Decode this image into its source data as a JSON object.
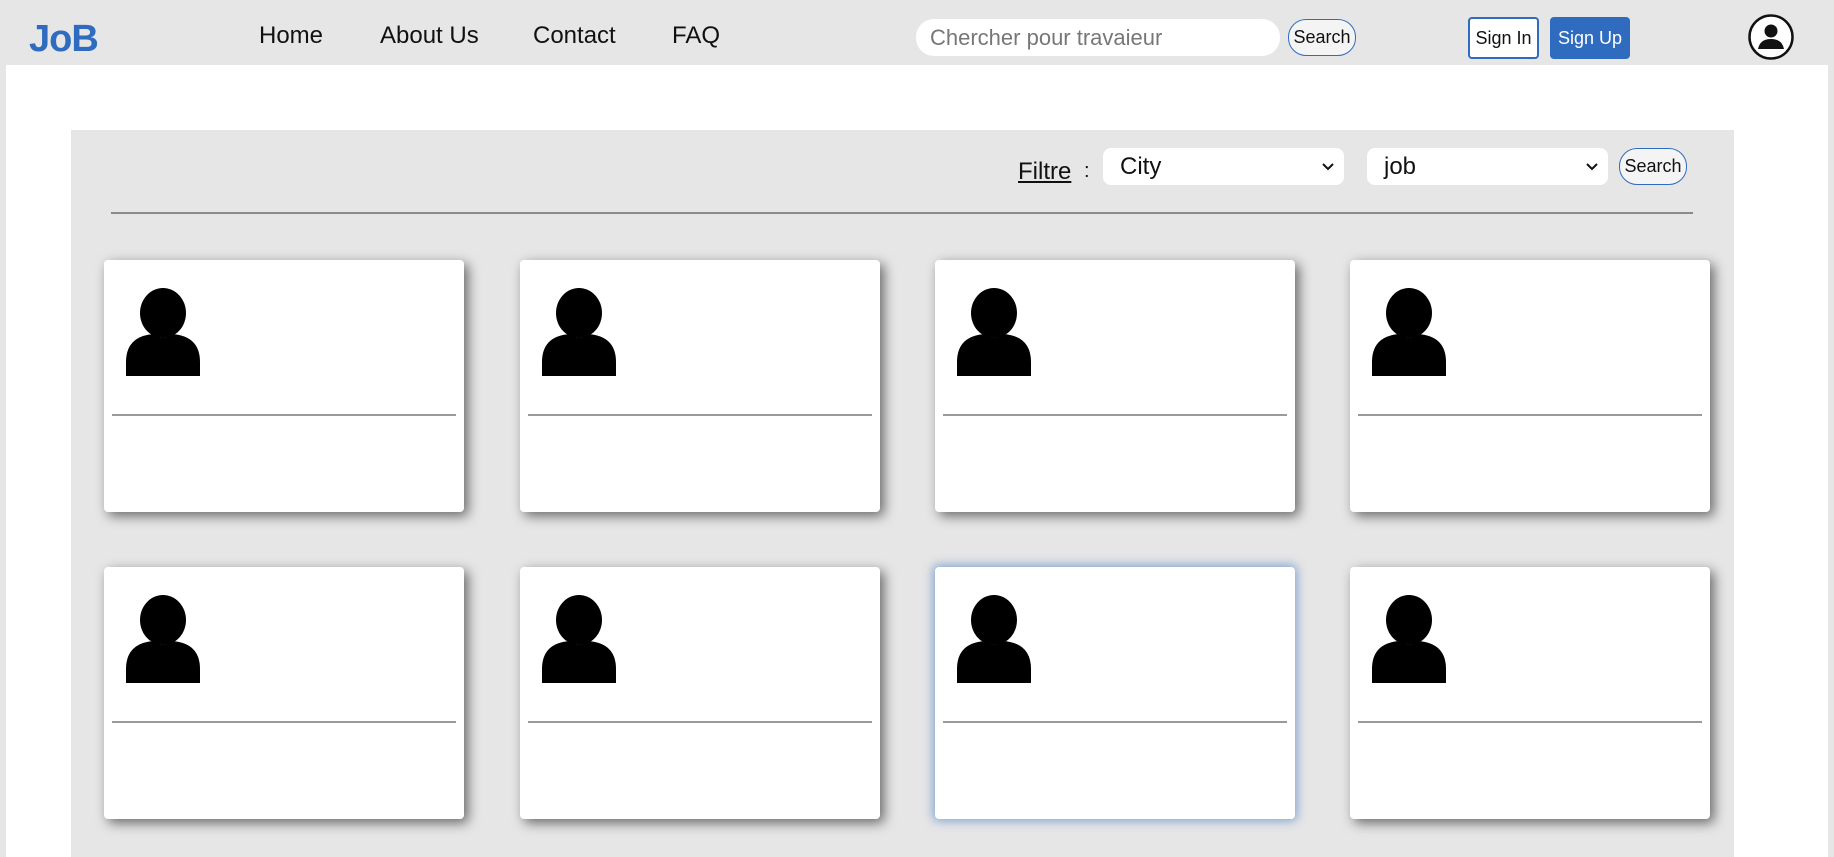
{
  "navbar": {
    "logo": "JoB",
    "links": [
      {
        "label": "Home"
      },
      {
        "label": "About Us"
      },
      {
        "label": "Contact"
      },
      {
        "label": "FAQ"
      }
    ],
    "search": {
      "placeholder": "Chercher pour travaieur",
      "value": "",
      "button_label": "Search"
    },
    "sign_in_label": "Sign In",
    "sign_up_label": "Sign Up",
    "user_icon": "user-circle-icon",
    "accent_color": "#2f6bbf"
  },
  "filters": {
    "label": "Filtre",
    "separator": ":",
    "city_select": {
      "selected": "City"
    },
    "job_select": {
      "selected": "job"
    },
    "search_label": "Search"
  },
  "cards": [
    {
      "icon": "person-icon",
      "focused": false
    },
    {
      "icon": "person-icon",
      "focused": false
    },
    {
      "icon": "person-icon",
      "focused": false
    },
    {
      "icon": "person-icon",
      "focused": false
    },
    {
      "icon": "person-icon",
      "focused": false
    },
    {
      "icon": "person-icon",
      "focused": false
    },
    {
      "icon": "person-icon",
      "focused": true
    },
    {
      "icon": "person-icon",
      "focused": false
    }
  ]
}
